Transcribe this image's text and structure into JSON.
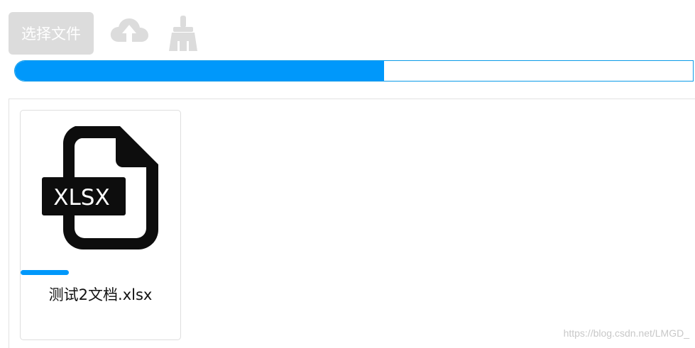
{
  "toolbar": {
    "choose_file_label": "选择文件",
    "upload_icon": "cloud-upload-icon",
    "clear_icon": "broom-icon"
  },
  "overall_progress": {
    "fraction": 0.545
  },
  "files": [
    {
      "name": "测试2文档.xlsx",
      "type_badge": "XLSX",
      "icon": "xlsx-file-icon",
      "progress_fraction": 0.3
    }
  ],
  "watermark": "https://blog.csdn.net/LMGD_",
  "colors": {
    "accent": "#0098fb",
    "button_bg": "#dcdcdc",
    "icon_gray": "#dcdcdc",
    "border": "#e2e2e2"
  }
}
